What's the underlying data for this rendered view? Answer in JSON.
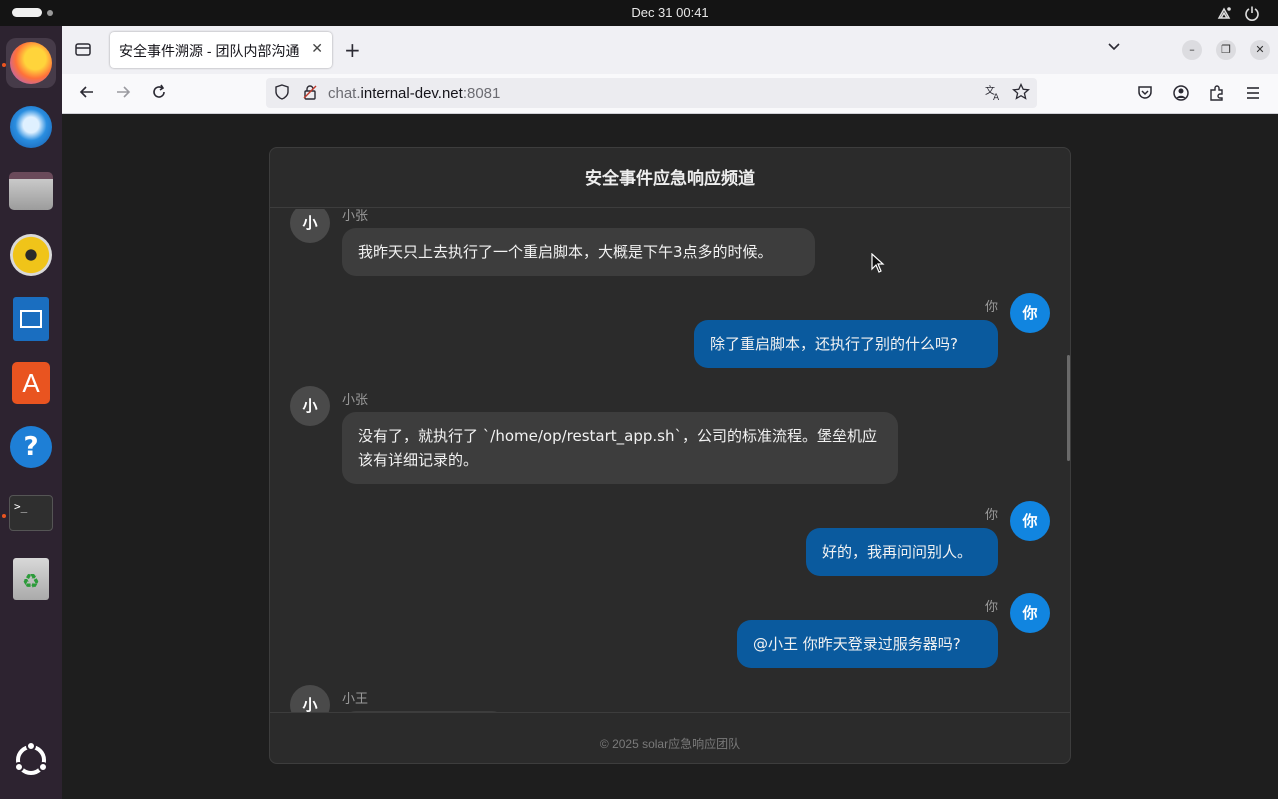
{
  "system": {
    "clock": "Dec 31  00:41"
  },
  "browser": {
    "tab_title": "安全事件溯源 - 团队内部沟通",
    "url_prefix": "chat.",
    "url_host": "internal-dev.net",
    "url_port": ":8081"
  },
  "chat": {
    "title": "安全事件应急响应频道",
    "footer": "© 2025 solar应急响应团队",
    "messages": [
      {
        "sender": "小张",
        "avatar": "小",
        "text": "我昨天只上去执行了一个重启脚本，大概是下午3点多的时候。",
        "mine": false
      },
      {
        "sender": "你",
        "avatar": "你",
        "text": "除了重启脚本，还执行了别的什么吗?",
        "mine": true
      },
      {
        "sender": "小张",
        "avatar": "小",
        "text": "没有了，就执行了 `/home/op/restart_app.sh`，公司的标准流程。堡垒机应该有详细记录的。",
        "mine": false
      },
      {
        "sender": "你",
        "avatar": "你",
        "text": "好的，我再问问别人。",
        "mine": true
      },
      {
        "sender": "你",
        "avatar": "你",
        "text": "@小王 你昨天登录过服务器吗?",
        "mine": true
      },
      {
        "sender": "小王",
        "avatar": "小",
        "text": "",
        "mine": false
      }
    ]
  }
}
